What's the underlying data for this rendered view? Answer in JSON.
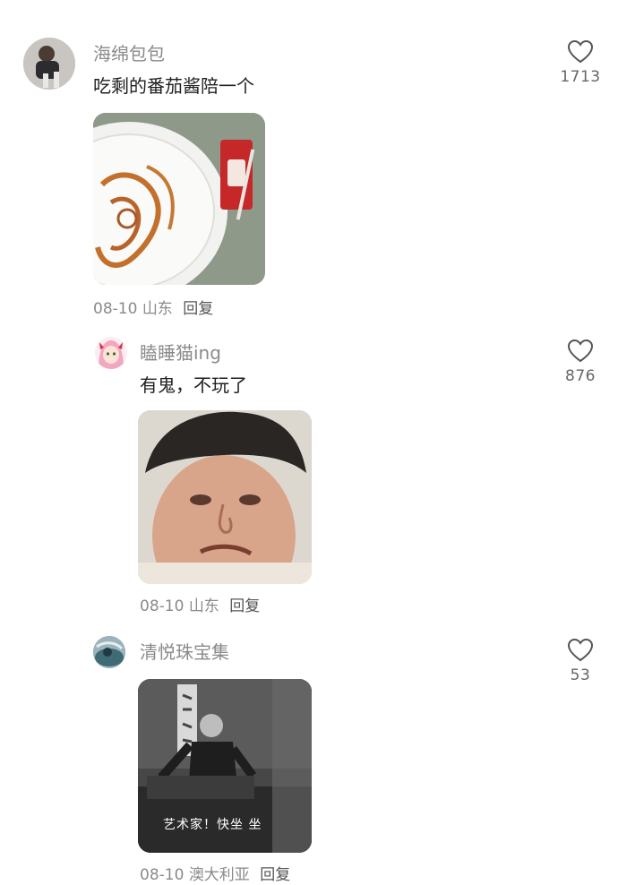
{
  "comments": [
    {
      "username": "海绵包包",
      "text": "吃剩的番茄酱陪一个",
      "likes": "1713",
      "date": "08-10",
      "location": "山东",
      "reply_label": "回复",
      "image_caption": ""
    },
    {
      "username": "瞌睡猫ing",
      "text": "有鬼，不玩了",
      "likes": "876",
      "date": "08-10",
      "location": "山东",
      "reply_label": "回复",
      "image_caption": ""
    },
    {
      "username": "清悦珠宝集",
      "text": "",
      "likes": "53",
      "date": "08-10",
      "location": "澳大利亚",
      "reply_label": "回复",
      "image_caption": "艺术家！快坐 坐"
    }
  ],
  "colors": {
    "username": "#8a8a8a",
    "meta": "#8a8a8a",
    "text": "#1f1f1f",
    "heart_outline": "#555555"
  },
  "icons": {
    "like": "heart-outline-icon"
  }
}
